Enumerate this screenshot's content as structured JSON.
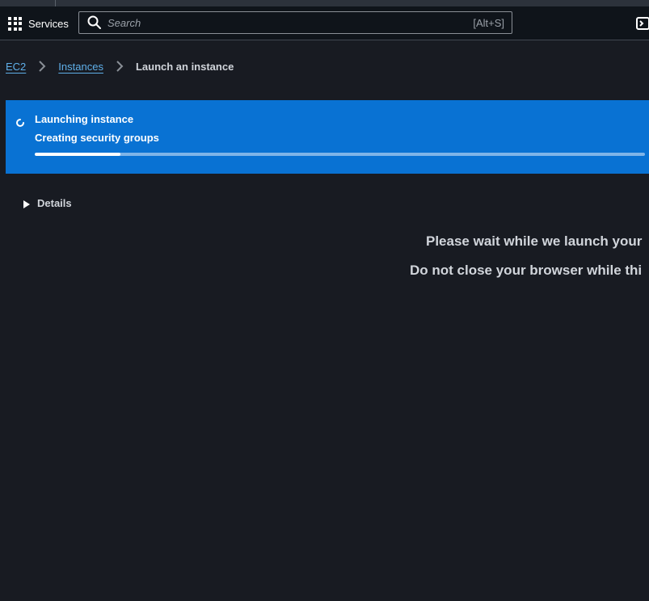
{
  "navbar": {
    "services_label": "Services",
    "search_placeholder": "Search",
    "search_shortcut": "[Alt+S]"
  },
  "breadcrumb": {
    "items": [
      {
        "label": "EC2"
      },
      {
        "label": "Instances"
      },
      {
        "label": "Launch an instance"
      }
    ]
  },
  "flash": {
    "title": "Launching instance",
    "subtitle": "Creating security groups",
    "progress_fraction": 0.14,
    "background_color": "#0972d3"
  },
  "details": {
    "label": "Details",
    "expanded": false
  },
  "messages": {
    "wait": "Please wait while we launch your",
    "close": "Do not close your browser while thi"
  },
  "icons": {
    "services": "grid-icon",
    "search": "search-icon",
    "cloudshell": "cloudshell-icon",
    "spinner": "spinner-icon",
    "details": "caret-right-icon",
    "breadcrumb_separator": "chevron-right-icon"
  }
}
